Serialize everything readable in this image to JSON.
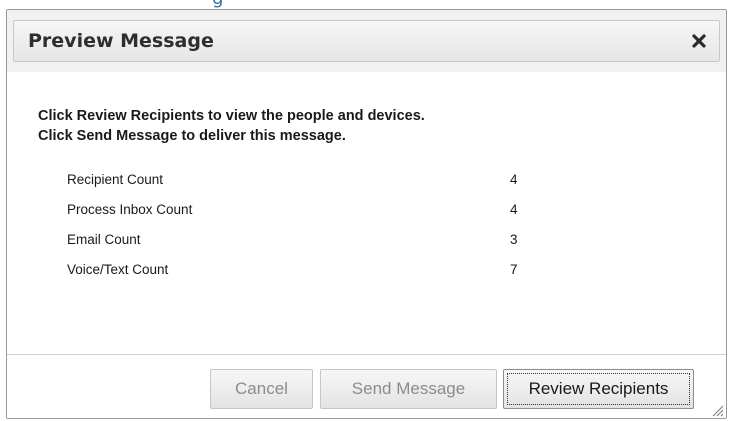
{
  "background_page": {
    "partial_heading": "g"
  },
  "dialog": {
    "title": "Preview Message",
    "close_glyph": "✖",
    "instructions": [
      "Click Review Recipients to view the people and devices.",
      "Click Send Message to deliver this message."
    ],
    "stats": [
      {
        "label": "Recipient Count",
        "value": "4"
      },
      {
        "label": "Process Inbox Count",
        "value": "4"
      },
      {
        "label": "Email Count",
        "value": "3"
      },
      {
        "label": "Voice/Text Count",
        "value": "7"
      }
    ],
    "buttons": {
      "cancel": "Cancel",
      "send": "Send Message",
      "review": "Review Recipients"
    }
  },
  "colors": {
    "heading_blue": "#3a6ea5",
    "disabled_text": "#8c8c8c",
    "title_text": "#2e2e2e"
  }
}
